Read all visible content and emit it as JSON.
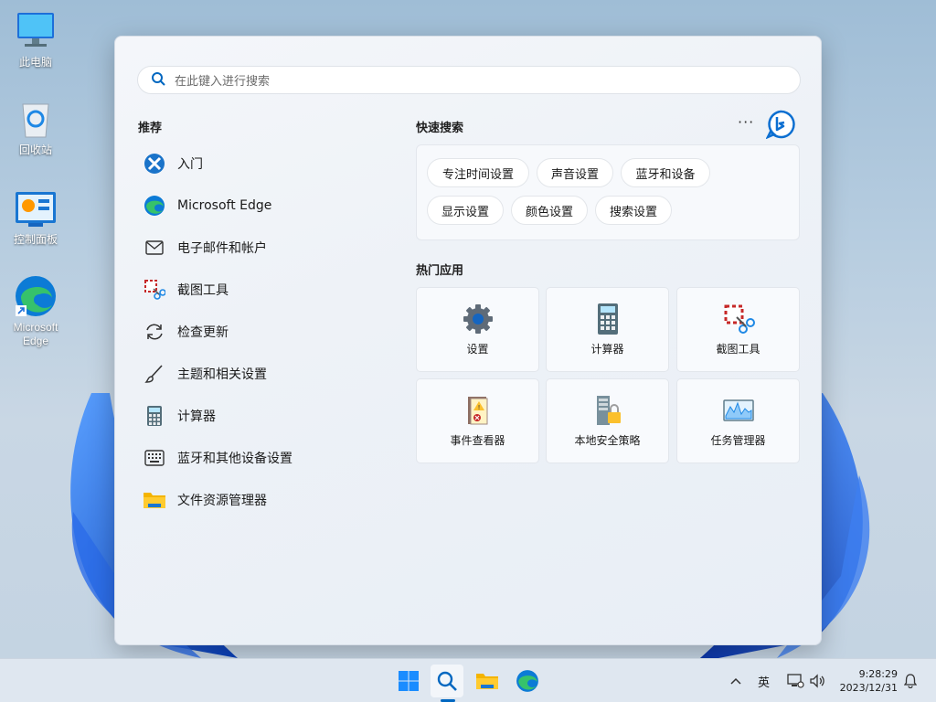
{
  "desktop": {
    "icons": [
      {
        "label": "此电脑",
        "icon": "computer-icon"
      },
      {
        "label": "回收站",
        "icon": "recycle-bin-icon"
      },
      {
        "label": "控制面板",
        "icon": "control-panel-icon"
      },
      {
        "label": "Microsoft Edge",
        "icon": "edge-icon"
      }
    ]
  },
  "start": {
    "search_placeholder": "在此键入进行搜索",
    "recommended_title": "推荐",
    "recommended": [
      {
        "label": "入门",
        "icon": "get-started-icon"
      },
      {
        "label": "Microsoft Edge",
        "icon": "edge-icon"
      },
      {
        "label": "电子邮件和帐户",
        "icon": "mail-icon"
      },
      {
        "label": "截图工具",
        "icon": "snipping-tool-icon"
      },
      {
        "label": "检查更新",
        "icon": "refresh-icon"
      },
      {
        "label": "主题和相关设置",
        "icon": "brush-icon"
      },
      {
        "label": "计算器",
        "icon": "calculator-icon"
      },
      {
        "label": "蓝牙和其他设备设置",
        "icon": "keyboard-icon"
      },
      {
        "label": "文件资源管理器",
        "icon": "folder-icon"
      }
    ],
    "quick_search_title": "快速搜索",
    "more_label": "···",
    "quick_search": [
      "专注时间设置",
      "声音设置",
      "蓝牙和设备",
      "显示设置",
      "颜色设置",
      "搜索设置"
    ],
    "top_apps_title": "热门应用",
    "top_apps": [
      {
        "label": "设置",
        "icon": "gear-icon"
      },
      {
        "label": "计算器",
        "icon": "calculator-icon"
      },
      {
        "label": "截图工具",
        "icon": "snipping-tool-icon"
      },
      {
        "label": "事件查看器",
        "icon": "event-viewer-icon"
      },
      {
        "label": "本地安全策略",
        "icon": "security-policy-icon"
      },
      {
        "label": "任务管理器",
        "icon": "task-manager-icon"
      }
    ]
  },
  "taskbar": {
    "ime": "英",
    "time": "9:28:29",
    "date": "2023/12/31"
  },
  "colors": {
    "accent": "#0067c0",
    "wallpaper_blue": "#1a5fd6"
  }
}
